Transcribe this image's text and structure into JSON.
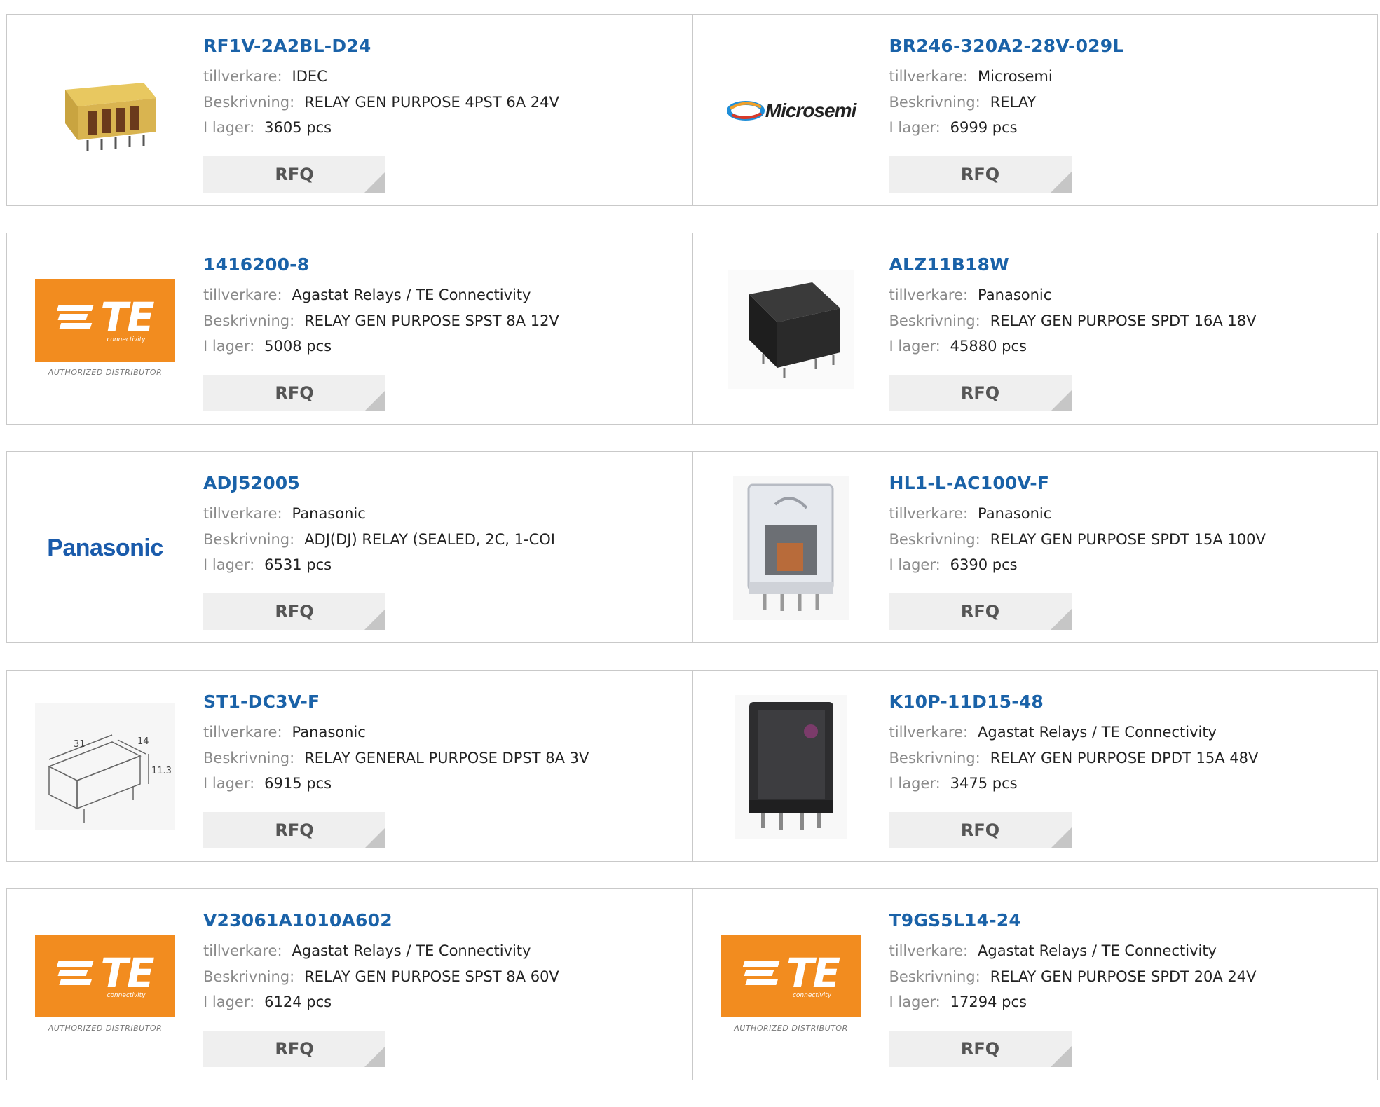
{
  "labels": {
    "manufacturer": "tillverkare:",
    "description": "Beskrivning:",
    "stock": "I lager:",
    "rfq": "RFQ"
  },
  "rows": [
    [
      {
        "part": "RF1V-2A2BL-D24",
        "manufacturer": "IDEC",
        "description": "RELAY GEN PURPOSE 4PST 6A 24V",
        "stock": "3605 pcs",
        "image": "relay-yellow-photo"
      },
      {
        "part": "BR246-320A2-28V-029L",
        "manufacturer": "Microsemi",
        "description": "RELAY",
        "stock": "6999 pcs",
        "image": "microsemi-logo",
        "logo_text": "Microsemi"
      }
    ],
    [
      {
        "part": "1416200-8",
        "manufacturer": "Agastat Relays / TE Connectivity",
        "description": "RELAY GEN PURPOSE SPST 8A 12V",
        "stock": "5008 pcs",
        "image": "te-logo"
      },
      {
        "part": "ALZ11B18W",
        "manufacturer": "Panasonic",
        "description": "RELAY GEN PURPOSE SPDT 16A 18V",
        "stock": "45880 pcs",
        "image": "relay-black-photo"
      }
    ],
    [
      {
        "part": "ADJ52005",
        "manufacturer": "Panasonic",
        "description": "ADJ(DJ) RELAY (SEALED, 2C, 1-COI",
        "stock": "6531 pcs",
        "image": "panasonic-logo",
        "logo_text": "Panasonic"
      },
      {
        "part": "HL1-L-AC100V-F",
        "manufacturer": "Panasonic",
        "description": "RELAY GEN PURPOSE SPDT 15A 100V",
        "stock": "6390 pcs",
        "image": "relay-clear-photo"
      }
    ],
    [
      {
        "part": "ST1-DC3V-F",
        "manufacturer": "Panasonic",
        "description": "RELAY GENERAL PURPOSE DPST 8A 3V",
        "stock": "6915 pcs",
        "image": "relay-drawing"
      },
      {
        "part": "K10P-11D15-48",
        "manufacturer": "Agastat Relays / TE Connectivity",
        "description": "RELAY GEN PURPOSE DPDT 15A 48V",
        "stock": "3475 pcs",
        "image": "relay-dark-cube-photo"
      }
    ],
    [
      {
        "part": "V23061A1010A602",
        "manufacturer": "Agastat Relays / TE Connectivity",
        "description": "RELAY GEN PURPOSE SPST 8A 60V",
        "stock": "6124 pcs",
        "image": "te-logo"
      },
      {
        "part": "T9GS5L14-24",
        "manufacturer": "Agastat Relays / TE Connectivity",
        "description": "RELAY GEN PURPOSE SPDT 20A 24V",
        "stock": "17294 pcs",
        "image": "te-logo"
      }
    ]
  ],
  "te_logo": {
    "mark": "TE",
    "sub": "connectivity",
    "caption": "AUTHORIZED DISTRIBUTOR"
  },
  "drawing_labels": {
    "d1": "31",
    "d2": "14",
    "d3": "11.3"
  }
}
